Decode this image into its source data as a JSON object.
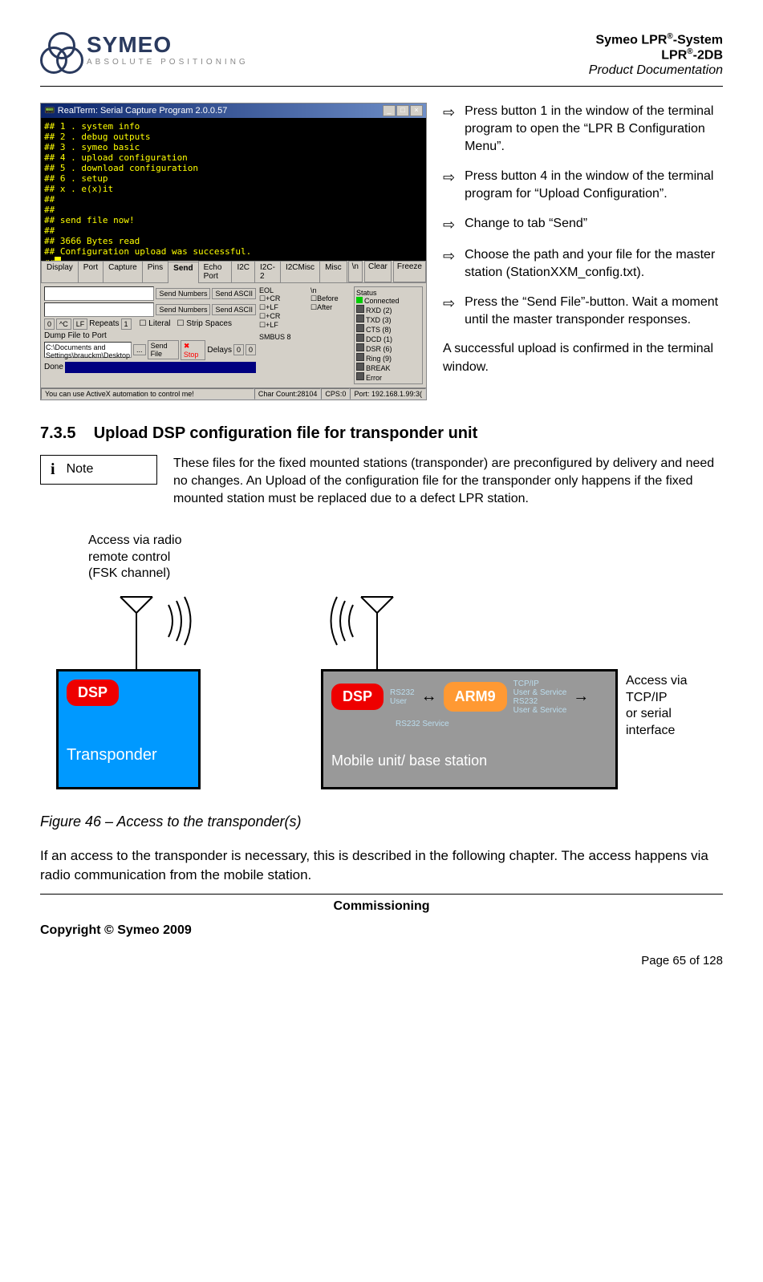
{
  "header": {
    "logo_main": "SYMEO",
    "logo_sub": "ABSOLUTE POSITIONING",
    "line1_a": "Symeo LPR",
    "line1_b": "-System",
    "line2_a": "LPR",
    "line2_b": "-2DB",
    "line3": "Product Documentation",
    "reg": "®"
  },
  "terminal": {
    "title": "RealTerm: Serial Capture Program 2.0.0.57",
    "console_lines": "## 1 . system info\n## 2 . debug outputs\n## 3 . symeo basic\n## 4 . upload configuration\n## 5 . download configuration\n## 6 . setup\n## x . e(x)it\n##\n##\n## send file now!\n##\n## 3666 Bytes read\n## Configuration upload was successful.\n##",
    "tabs": [
      "Display",
      "Port",
      "Capture",
      "Pins",
      "Send",
      "Echo Port",
      "I2C",
      "I2C-2",
      "I2CMisc",
      "Misc"
    ],
    "active_tab": "Send",
    "btn_clear": "Clear",
    "btn_freeze": "Freeze",
    "btn_newline": "\\n",
    "btn_send_numbers": "Send Numbers",
    "btn_send_ascii": "Send ASCII",
    "eol_label": "EOL",
    "eol_cr": "+CR",
    "eol_lf": "+LF",
    "before": "Before",
    "after": "After",
    "boxnl": "\\n",
    "literal": "Literal",
    "strip": "Strip Spaces",
    "repeats": "Repeats",
    "zero": "0",
    "cc": "^C",
    "lf": "LF",
    "one": "1",
    "smbus": "SMBUS 8",
    "dump_label": "Dump File to Port",
    "dump_path": "C:\\Documents and Settings\\brauckm\\Desktop",
    "browse": "...",
    "sendfile": "Send File",
    "stop": "Stop",
    "x": "x",
    "delays": "Delays",
    "done": "Done",
    "status_title": "Status",
    "status_items": [
      "Connected",
      "RXD (2)",
      "TXD (3)",
      "CTS (8)",
      "DCD (1)",
      "DSR (6)",
      "Ring (9)",
      "BREAK",
      "Error"
    ],
    "statusbar_hint": "You can use ActiveX automation to control me!",
    "statusbar_count": "Char Count:28104",
    "statusbar_cps": "CPS:0",
    "statusbar_port": "Port: 192.168.1.99:3("
  },
  "steps": {
    "items": [
      "Press button 1 in the window of the terminal program to open the “LPR B Configuration Menu”.",
      "Press button 4 in the window of the terminal program for “Upload Configuration”.",
      "Change to tab “Send”",
      "Choose the path and your file for the master station (StationXXM_config.txt).",
      "Press the “Send File”-button. Wait a moment until the master transponder responses."
    ],
    "final": "A successful upload is confirmed in the terminal window."
  },
  "section": {
    "number": "7.3.5",
    "title": "Upload DSP configuration file for transponder unit"
  },
  "note": {
    "icon": "i",
    "label": "Note",
    "text": "These files for the fixed mounted stations (transponder) are preconfigured by delivery and need no changes. An Upload of the configuration file for the transponder only happens if the fixed mounted station must be replaced due to a defect LPR station."
  },
  "diagram": {
    "left_label": "Access via radio\nremote control\n(FSK channel)",
    "dsp": "DSP",
    "transponder": "Transponder",
    "arm9": "ARM9",
    "rs232_user": "RS232\nUser",
    "tcpip": "TCP/IP\nUser & Service\nRS232\nUser & Service",
    "rs232_service": "RS232 Service",
    "mobile_caption": "Mobile unit/ base station",
    "right_label": "Access via\nTCP/IP\nor serial\ninterface"
  },
  "figure_caption": "Figure 46 – Access to the transponder(s)",
  "body_para": "If an access to the transponder is necessary, this is described in the following chapter. The access happens via radio communication from the mobile station.",
  "footer": {
    "commissioning": "Commissioning",
    "copyright": "Copyright © Symeo 2009",
    "page": "Page 65 of 128"
  }
}
